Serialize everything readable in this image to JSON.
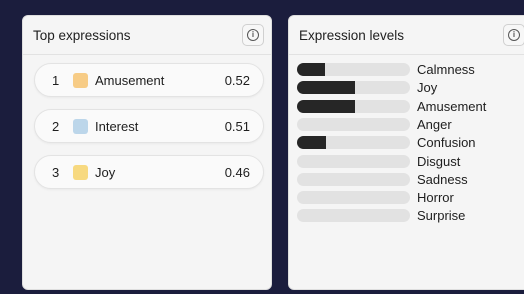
{
  "top_panel": {
    "title": "Top expressions",
    "items": [
      {
        "rank": "1",
        "name": "Amusement",
        "score": "0.52",
        "color": "#f7cc86"
      },
      {
        "rank": "2",
        "name": "Interest",
        "score": "0.51",
        "color": "#bcd6ea"
      },
      {
        "rank": "3",
        "name": "Joy",
        "score": "0.46",
        "color": "#f7d980"
      }
    ]
  },
  "levels_panel": {
    "title": "Expression levels",
    "items": [
      {
        "name": "Calmness",
        "level": 0.25
      },
      {
        "name": "Joy",
        "level": 0.51
      },
      {
        "name": "Amusement",
        "level": 0.51
      },
      {
        "name": "Anger",
        "level": 0
      },
      {
        "name": "Confusion",
        "level": 0.26
      },
      {
        "name": "Disgust",
        "level": 0
      },
      {
        "name": "Sadness",
        "level": 0
      },
      {
        "name": "Horror",
        "level": 0
      },
      {
        "name": "Surprise",
        "level": 0
      }
    ]
  },
  "icons": {
    "info": "info-icon"
  },
  "colors": {
    "background": "#1b1d3d",
    "bar_fill": "#262626",
    "bar_track": "#e2e2e2"
  }
}
